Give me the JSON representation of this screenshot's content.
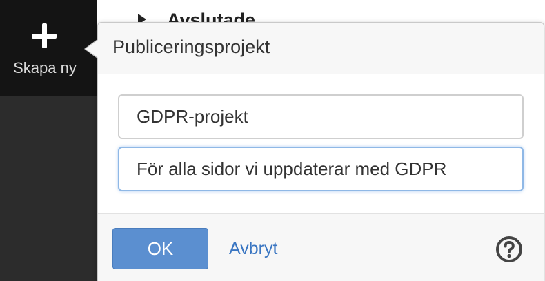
{
  "sidebar": {
    "create_label": "Skapa ny",
    "create_icon": "plus-icon"
  },
  "background": {
    "heading": "Avslutade"
  },
  "popover": {
    "title": "Publiceringsprojekt",
    "name_value": "GDPR-projekt",
    "description_value": "För alla sidor vi uppdaterar med GDPR",
    "ok_label": "OK",
    "cancel_label": "Avbryt",
    "help_icon": "question-circle-icon"
  },
  "colors": {
    "primary": "#5b8fd0",
    "link": "#3a76c2",
    "sidebar": "#2c2c2c",
    "focus_border": "#8fb8e6"
  }
}
